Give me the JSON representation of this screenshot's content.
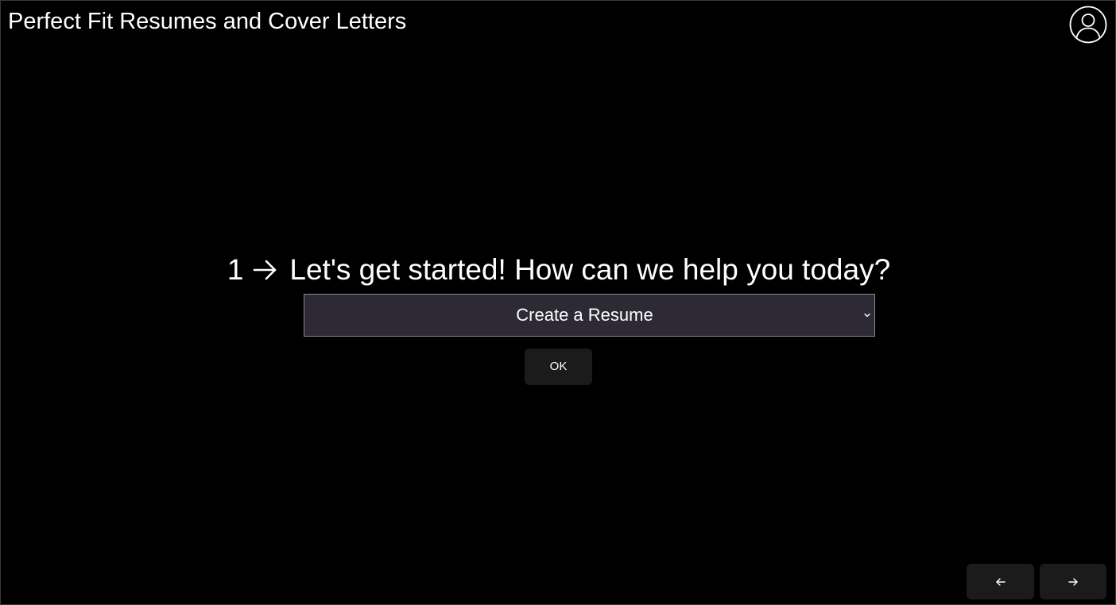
{
  "header": {
    "title": "Perfect Fit Resumes and Cover Letters",
    "profile_icon": "user-circle-icon"
  },
  "question": {
    "number": "1",
    "arrow_icon": "arrow-right-icon",
    "text": "Let's get started! How can we help you today?"
  },
  "select": {
    "selected_value": "Create a Resume",
    "chevron_icon": "chevron-down-icon"
  },
  "ok_button": {
    "label": "OK"
  },
  "navigation": {
    "prev_icon": "arrow-left-icon",
    "next_icon": "arrow-right-icon"
  },
  "colors": {
    "background": "#000000",
    "text": "#ffffff",
    "select_background": "#2d2a36",
    "button_background": "#1b1b1c"
  }
}
